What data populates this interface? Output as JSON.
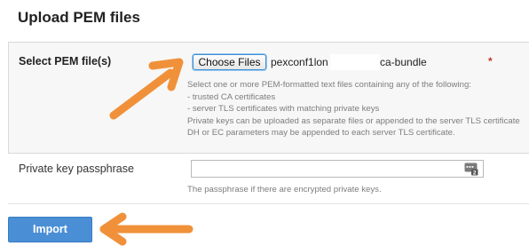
{
  "page": {
    "title": "Upload PEM files"
  },
  "pem_row": {
    "label": "Select PEM file(s)",
    "choose_button": "Choose Files",
    "file_name_part1": "pexconf1lon",
    "file_name_part2": "ca-bundle",
    "required_marker": "*",
    "help_lines": [
      "Select one or more PEM-formatted text files containing any of the following:",
      "- trusted CA certificates",
      "- server TLS certificates with matching private keys",
      "Private keys can be uploaded as separate files or appended to the server TLS certificate",
      "DH or EC parameters may be appended to each server TLS certificate."
    ]
  },
  "passphrase_row": {
    "label": "Private key passphrase",
    "value": "",
    "help": "The passphrase if there are encrypted private keys."
  },
  "actions": {
    "import_label": "Import"
  },
  "icons": {
    "password_manager": "password-manager-icon",
    "annotation_arrows": "orange-arrow"
  },
  "colors": {
    "accent": "#4a8fd6",
    "arrow": "#f0913a",
    "required": "#c0392b"
  }
}
